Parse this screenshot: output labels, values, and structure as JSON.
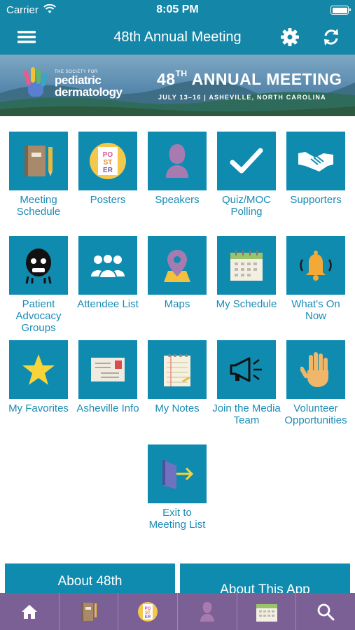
{
  "status_bar": {
    "carrier": "Carrier",
    "time": "8:05 PM"
  },
  "nav": {
    "title": "48th Annual Meeting"
  },
  "banner": {
    "org_small": "THE SOCIETY FOR",
    "org_line1": "pediatric",
    "org_line2": "dermatology",
    "headline_num": "48",
    "headline_sup": "TH",
    "headline_text": " ANNUAL MEETING",
    "subtitle": "JULY 13–16 | ASHEVILLE, NORTH CAROLINA"
  },
  "tiles": [
    {
      "label": "Meeting Schedule",
      "icon": "notebook-icon"
    },
    {
      "label": "Posters",
      "icon": "poster-icon"
    },
    {
      "label": "Speakers",
      "icon": "person-silhouette-icon"
    },
    {
      "label": "Quiz/MOC Polling",
      "icon": "checkmark-icon"
    },
    {
      "label": "Supporters",
      "icon": "handshake-icon"
    },
    {
      "label": "Patient Advocacy Groups",
      "icon": "advocacy-face-icon"
    },
    {
      "label": "Attendee List",
      "icon": "group-icon"
    },
    {
      "label": "Maps",
      "icon": "map-pin-icon"
    },
    {
      "label": "My Schedule",
      "icon": "calendar-icon"
    },
    {
      "label": "What's On Now",
      "icon": "bell-icon"
    },
    {
      "label": "My Favorites",
      "icon": "star-icon"
    },
    {
      "label": "Asheville Info",
      "icon": "envelope-icon"
    },
    {
      "label": "My Notes",
      "icon": "notepad-icon"
    },
    {
      "label": "Join the Media Team",
      "icon": "megaphone-icon"
    },
    {
      "label": "Volunteer Opportunities",
      "icon": "raised-hand-icon"
    },
    {
      "label": "Exit to Meeting List",
      "icon": "exit-door-icon"
    }
  ],
  "bottom_buttons": {
    "about_meeting": "About 48th",
    "about_app": "About This App"
  },
  "tabbar": [
    "home-icon",
    "notebook-icon",
    "poster-icon",
    "person-silhouette-icon",
    "calendar-icon",
    "search-icon"
  ]
}
